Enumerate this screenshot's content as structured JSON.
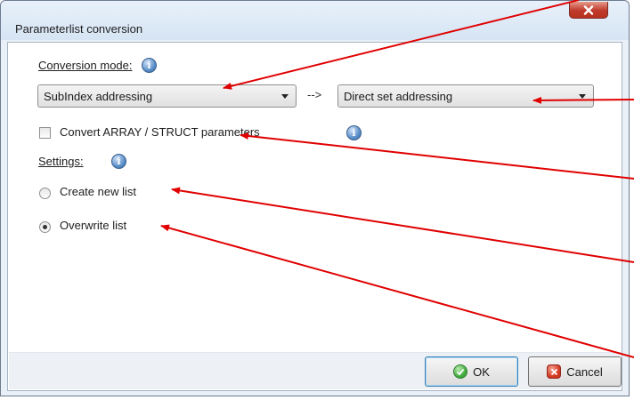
{
  "window": {
    "title": "Parameterlist conversion",
    "close_icon": "close-x-icon"
  },
  "conversion": {
    "label": "Conversion mode:",
    "source_value": "SubIndex addressing",
    "separator": "-->",
    "target_value": "Direct set addressing"
  },
  "convert_array": {
    "label": "Convert ARRAY / STRUCT parameters",
    "checked": false
  },
  "settings": {
    "label": "Settings:",
    "options": [
      {
        "label": "Create new list",
        "selected": false
      },
      {
        "label": "Overwrite list",
        "selected": true
      }
    ]
  },
  "buttons": {
    "ok_label": "OK",
    "cancel_label": "Cancel"
  },
  "colors": {
    "annotation_arrow": "#e00000",
    "close_button": "#c0392b",
    "ok_icon": "#3ea83a",
    "cancel_icon": "#d2371f",
    "info_icon": "#5b8fc9"
  }
}
